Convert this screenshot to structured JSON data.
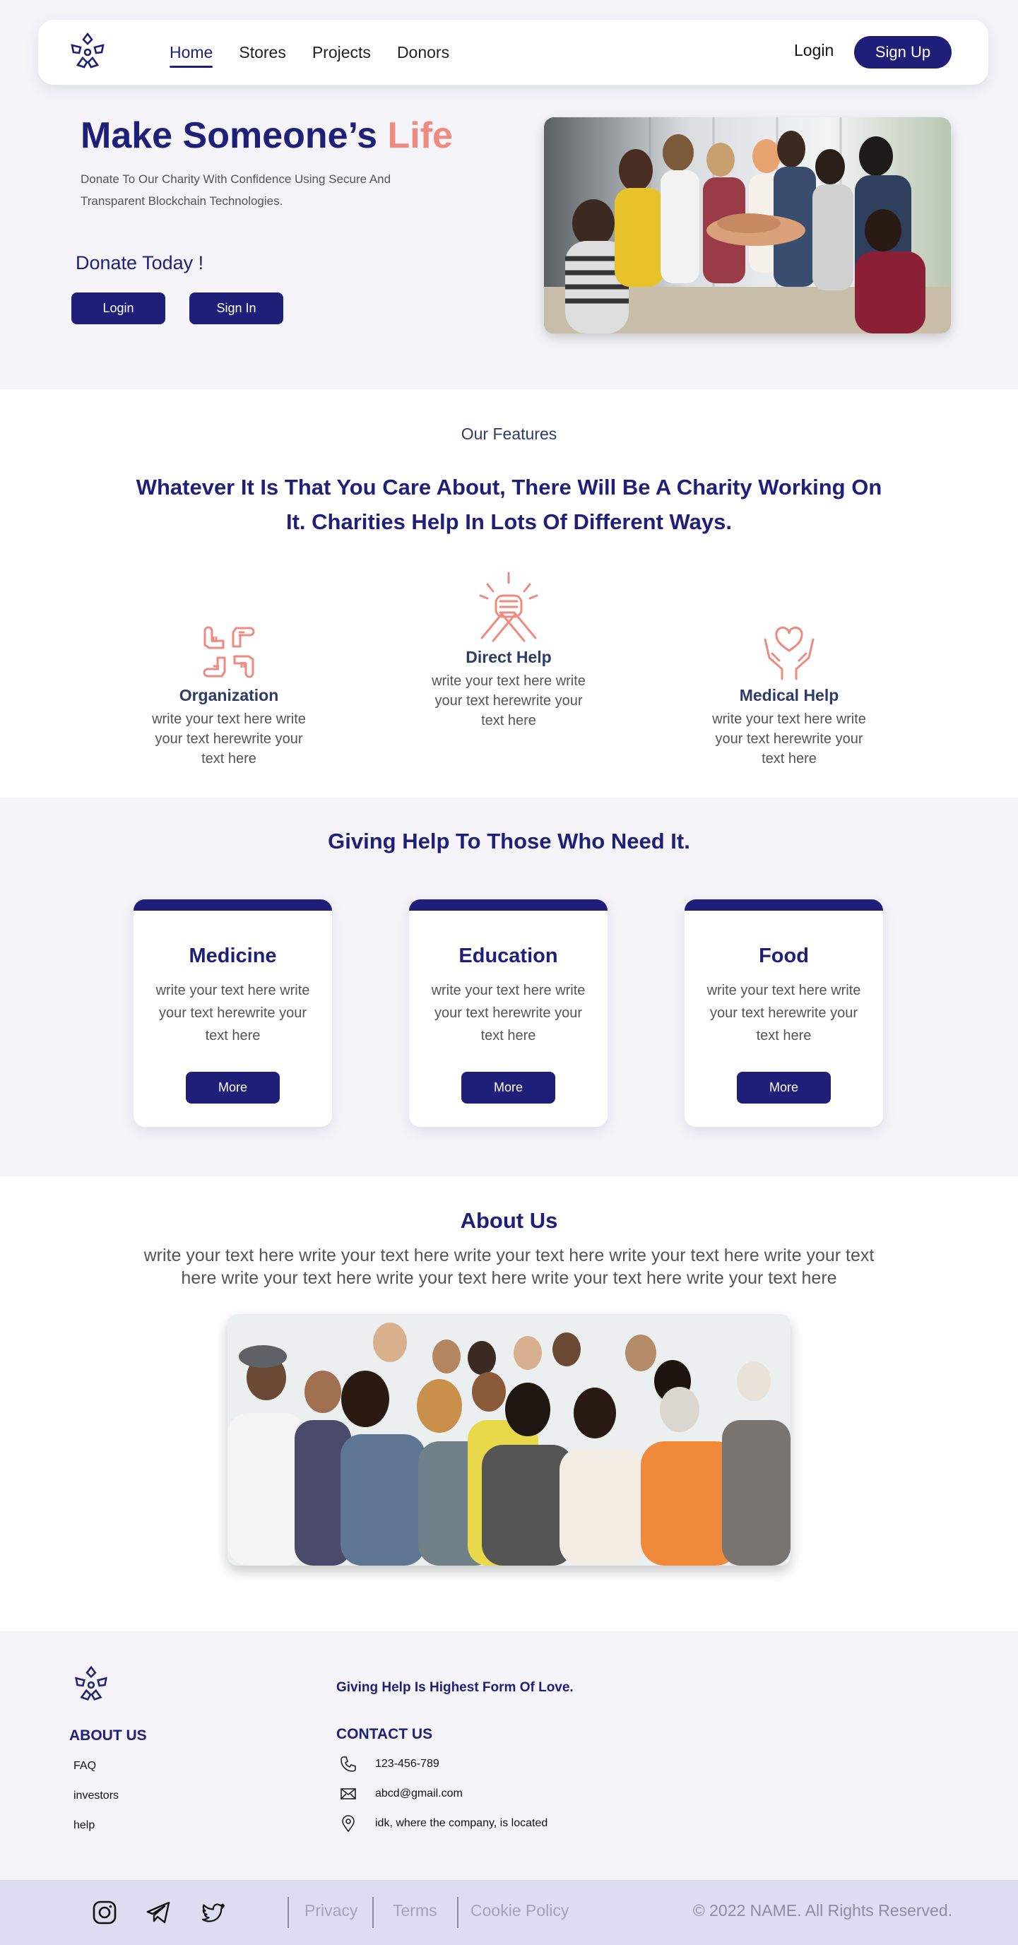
{
  "nav": {
    "links": [
      {
        "label": "Home",
        "active": true
      },
      {
        "label": "Stores",
        "active": false
      },
      {
        "label": "Projects",
        "active": false
      },
      {
        "label": "Donors",
        "active": false
      }
    ],
    "login": "Login",
    "signup": "Sign Up"
  },
  "hero": {
    "title_main": "Make Someone’s",
    "title_accent": "Life",
    "subtitle": "Donate To Our Charity With Confidence Using Secure And Transparent Blockchain Technologies.",
    "donate_today": "Donate Today !",
    "login_button": "Login",
    "signin_button": "Sign In"
  },
  "features": {
    "eyebrow": "Our Features",
    "headline": "Whatever It Is That You Care About, There Will Be A Charity Working On It. Charities Help In Lots Of Different Ways.",
    "items": [
      {
        "title": "Organization",
        "text": "write your text here write your text herewrite your text here",
        "icon": "hands-together-icon"
      },
      {
        "title": "Direct Help",
        "text": "write your text here write your text herewrite your text here",
        "icon": "handshake-icon"
      },
      {
        "title": "Medical Help",
        "text": "write your text here write your text herewrite your text here",
        "icon": "heart-hands-icon"
      }
    ]
  },
  "giving": {
    "title": "Giving Help To Those Who Need It.",
    "cards": [
      {
        "title": "Medicine",
        "text": "write your text here write your text herewrite your text here",
        "button": "More"
      },
      {
        "title": "Education",
        "text": "write your text here write your text herewrite your text here",
        "button": "More"
      },
      {
        "title": "Food",
        "text": "write your text here write your text herewrite your text here",
        "button": "More"
      }
    ]
  },
  "about": {
    "title": "About Us",
    "text": "write your text here write your text here write your text here write your text here write your text here write your text here write your text here write your text here write your text here"
  },
  "footer": {
    "tagline": "Giving Help Is Highest Form Of Love.",
    "about_heading": "ABOUT US",
    "about_links": [
      "FAQ",
      "investors",
      "help"
    ],
    "contact_heading": "CONTACT US",
    "contact": {
      "phone": "123-456-789",
      "email": "abcd@gmail.com",
      "address": "idk, where the company, is located"
    },
    "social_icons": [
      "instagram-icon",
      "telegram-icon",
      "twitter-icon"
    ],
    "legal_links": [
      "Privacy",
      "Terms",
      "Cookie Policy"
    ],
    "copyright": "© 2022 NAME. All Rights Reserved."
  },
  "colors": {
    "navy": "#1f1f7a",
    "accent": "#ee8a80",
    "background": "#f4f4f9",
    "footer_bar": "#dcddf0"
  }
}
